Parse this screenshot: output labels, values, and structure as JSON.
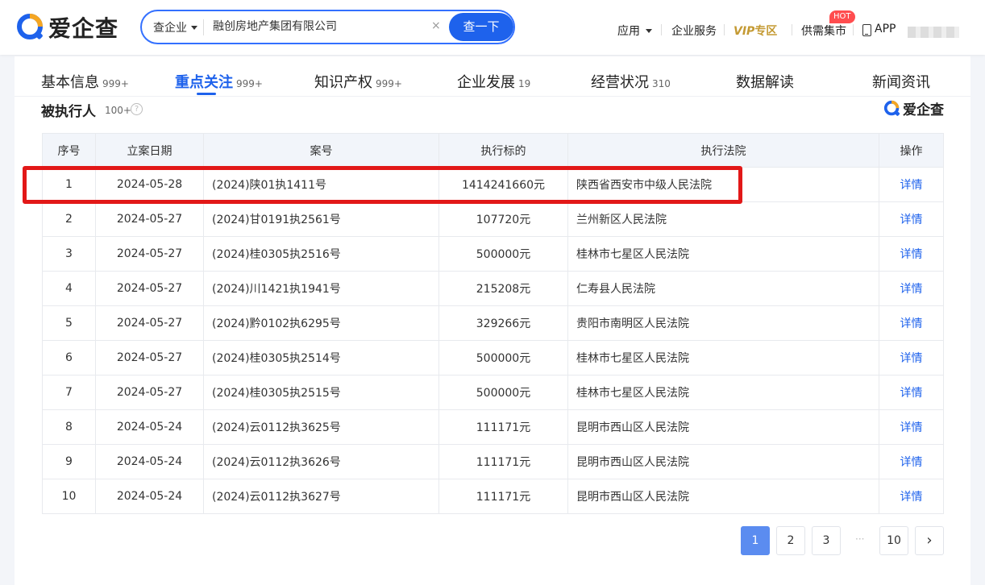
{
  "header": {
    "logo_text": "爱企查",
    "search": {
      "type_label": "查企业",
      "query": "融创房地产集团有限公司",
      "clear_label": "×",
      "button_label": "查一下"
    },
    "nav": {
      "apps": "应用",
      "enterprise_service": "企业服务",
      "vip_prefix": "VIP",
      "vip_suffix": "专区",
      "market": "供需集市",
      "hot_badge": "HOT",
      "app": "APP"
    }
  },
  "tabs": [
    {
      "label": "基本信息",
      "count": "999+"
    },
    {
      "label": "重点关注",
      "count": "999+"
    },
    {
      "label": "知识产权",
      "count": "999+"
    },
    {
      "label": "企业发展",
      "count": "19"
    },
    {
      "label": "经营状况",
      "count": "310"
    },
    {
      "label": "数据解读",
      "count": ""
    },
    {
      "label": "新闻资讯",
      "count": ""
    }
  ],
  "section": {
    "title": "被执行人",
    "count": "100+",
    "help": "?",
    "brand": "爱企查"
  },
  "table": {
    "headers": [
      "序号",
      "立案日期",
      "案号",
      "执行标的",
      "执行法院",
      "操作"
    ],
    "rows": [
      [
        "1",
        "2024-05-28",
        "(2024)陕01执1411号",
        "1414241660元",
        "陕西省西安市中级人民法院",
        "详情"
      ],
      [
        "2",
        "2024-05-27",
        "(2024)甘0191执2561号",
        "107720元",
        "兰州新区人民法院",
        "详情"
      ],
      [
        "3",
        "2024-05-27",
        "(2024)桂0305执2516号",
        "500000元",
        "桂林市七星区人民法院",
        "详情"
      ],
      [
        "4",
        "2024-05-27",
        "(2024)川1421执1941号",
        "215208元",
        "仁寿县人民法院",
        "详情"
      ],
      [
        "5",
        "2024-05-27",
        "(2024)黔0102执6295号",
        "329266元",
        "贵阳市南明区人民法院",
        "详情"
      ],
      [
        "6",
        "2024-05-27",
        "(2024)桂0305执2514号",
        "500000元",
        "桂林市七星区人民法院",
        "详情"
      ],
      [
        "7",
        "2024-05-27",
        "(2024)桂0305执2515号",
        "500000元",
        "桂林市七星区人民法院",
        "详情"
      ],
      [
        "8",
        "2024-05-24",
        "(2024)云0112执3625号",
        "111171元",
        "昆明市西山区人民法院",
        "详情"
      ],
      [
        "9",
        "2024-05-24",
        "(2024)云0112执3626号",
        "111171元",
        "昆明市西山区人民法院",
        "详情"
      ],
      [
        "10",
        "2024-05-24",
        "(2024)云0112执3627号",
        "111171元",
        "昆明市西山区人民法院",
        "详情"
      ]
    ]
  },
  "pagination": {
    "pages": [
      "1",
      "2",
      "3",
      "10"
    ],
    "current": "1",
    "ellipsis": "···",
    "next": "›"
  },
  "colors": {
    "brand_blue": "#1e62ec",
    "highlight_red": "#e21818",
    "vip_gold": "#c49a33",
    "hot_red": "#ff4d4f"
  }
}
